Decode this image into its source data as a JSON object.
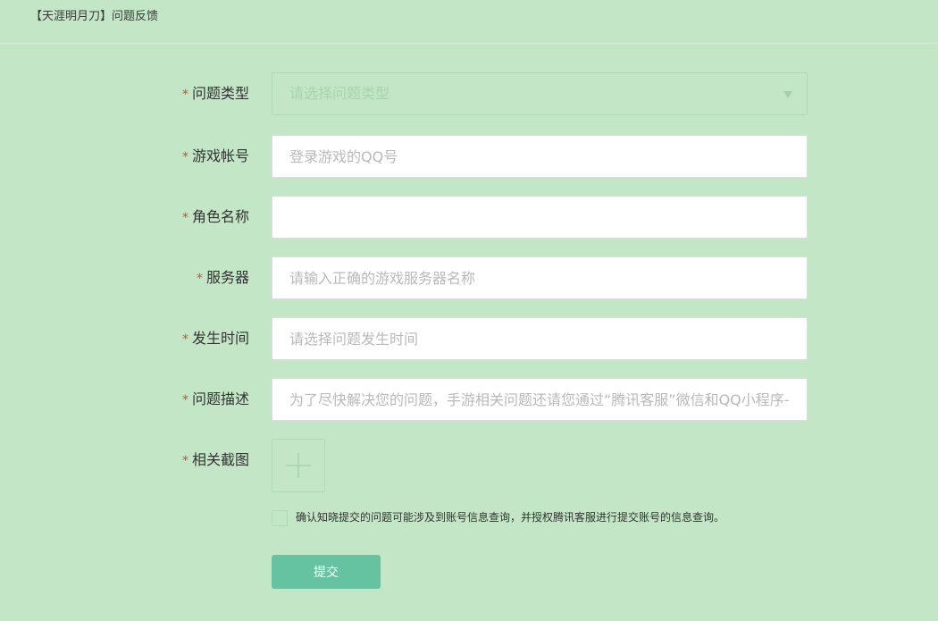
{
  "header": {
    "title": "【天涯明月刀】问题反馈"
  },
  "form": {
    "required_mark": "*",
    "issue_type": {
      "label": "问题类型",
      "placeholder": "请选择问题类型"
    },
    "game_account": {
      "label": "游戏帐号",
      "placeholder": "登录游戏的QQ号",
      "value": ""
    },
    "role_name": {
      "label": "角色名称",
      "placeholder": "",
      "value": ""
    },
    "server": {
      "label": "服务器",
      "placeholder": "请输入正确的游戏服务器名称",
      "value": ""
    },
    "occur_time": {
      "label": "发生时间",
      "placeholder": "请选择问题发生时间",
      "value": ""
    },
    "description": {
      "label": "问题描述",
      "placeholder": "为了尽快解决您的问题，手游相关问题还请您通过“腾讯客服”微信和QQ小程序-",
      "value": ""
    },
    "screenshot": {
      "label": "相关截图"
    },
    "consent_text": "确认知晓提交的问题可能涉及到账号信息查询，并授权腾讯客服进行提交账号的信息查询。",
    "submit_label": "提交"
  },
  "icons": {
    "select_arrow": "chevron-down-icon",
    "upload": "plus-icon"
  },
  "colors": {
    "background": "#c3e6c6",
    "required": "#e2452b",
    "submit": "#66c3a2"
  }
}
